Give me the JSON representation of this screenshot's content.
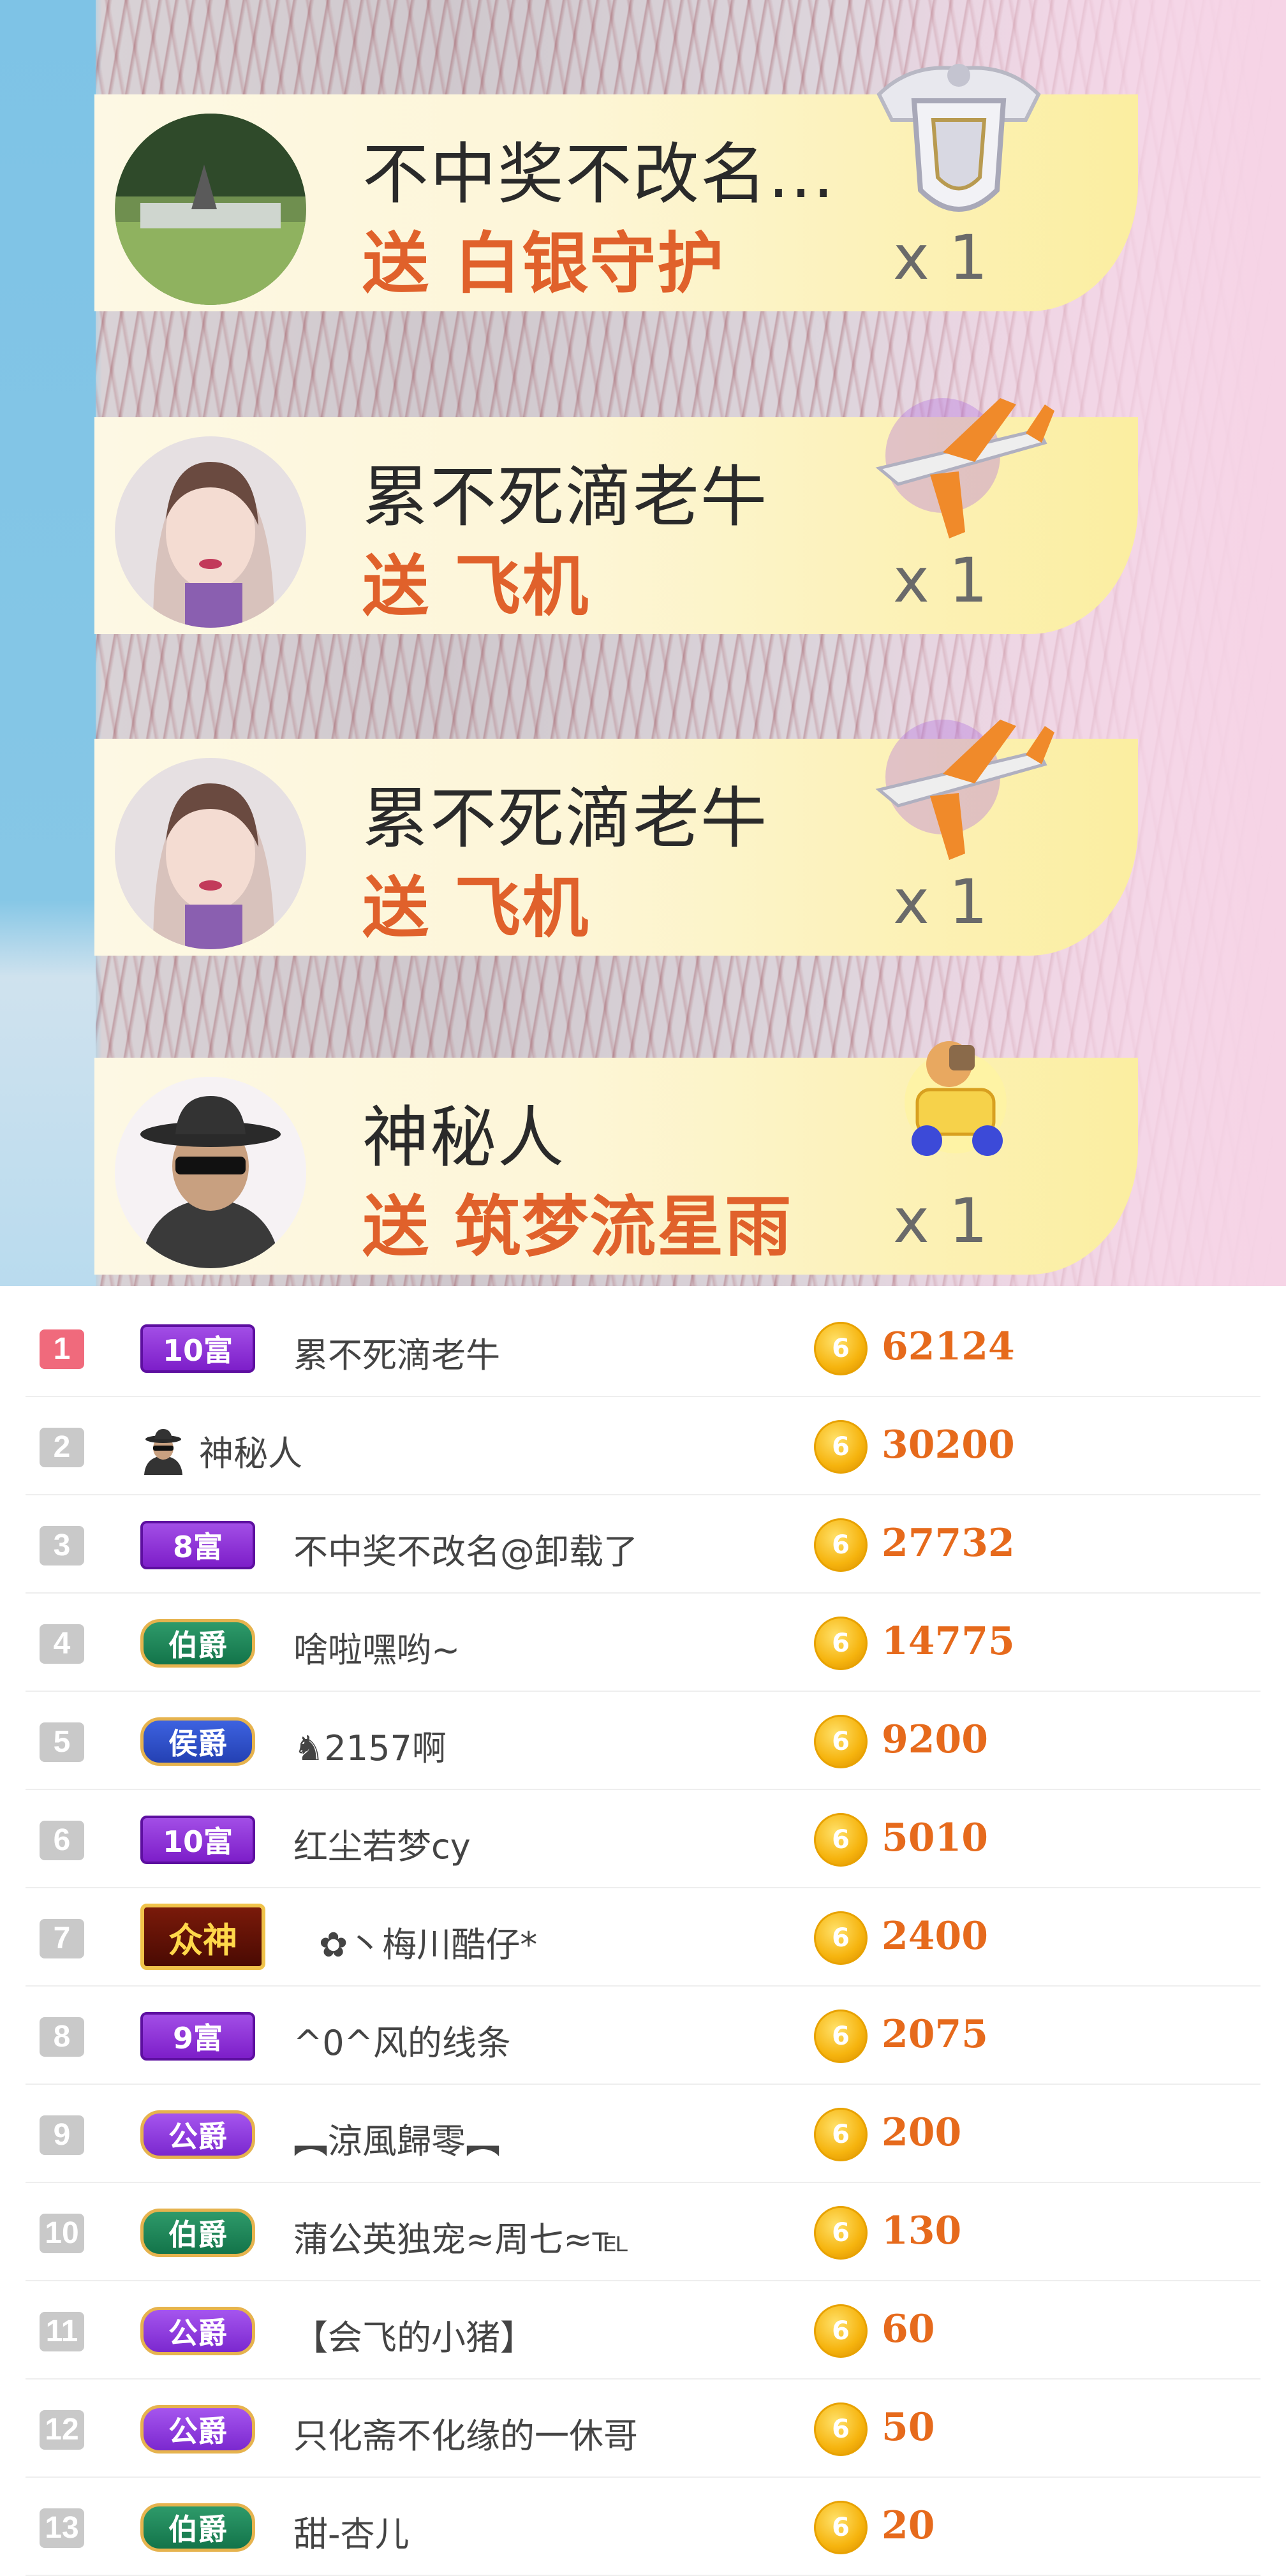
{
  "gift_stream": [
    {
      "sender": "不中奖不改名...",
      "action": "送 白银守护",
      "count": "x 1",
      "gift_icon": "silver-guard-shield-icon",
      "avatar": "landscape-photo"
    },
    {
      "sender": "累不死滴老牛",
      "action": "送 飞机",
      "count": "x 1",
      "gift_icon": "airplane-icon",
      "avatar": "woman-portrait"
    },
    {
      "sender": "累不死滴老牛",
      "action": "送 飞机",
      "count": "x 1",
      "gift_icon": "airplane-icon",
      "avatar": "woman-portrait"
    },
    {
      "sender": "神秘人",
      "action": "送 筑梦流星雨",
      "count": "x 1",
      "gift_icon": "meteor-car-icon",
      "avatar": "mystery-man"
    }
  ],
  "ranking": [
    {
      "rank": "1",
      "badge": "10富",
      "badge_type": "fu",
      "name": "累不死滴老牛",
      "score": "62124"
    },
    {
      "rank": "2",
      "badge": "",
      "badge_type": "mystery",
      "name": "神秘人",
      "score": "30200"
    },
    {
      "rank": "3",
      "badge": "8富",
      "badge_type": "fu",
      "name": "不中奖不改名@卸载了",
      "score": "27732"
    },
    {
      "rank": "4",
      "badge": "伯爵",
      "badge_type": "bo",
      "name": "啥啦嘿哟~",
      "score": "14775"
    },
    {
      "rank": "5",
      "badge": "侯爵",
      "badge_type": "hou",
      "name": "♞2157啊",
      "score": "9200"
    },
    {
      "rank": "6",
      "badge": "10富",
      "badge_type": "fu",
      "name": "红尘若梦cy",
      "score": "5010"
    },
    {
      "rank": "7",
      "badge": "众神",
      "badge_type": "zhong",
      "name": "✿丶梅川酷仔*",
      "score": "2400"
    },
    {
      "rank": "8",
      "badge": "9富",
      "badge_type": "fu",
      "name": "^0^风的线条",
      "score": "2075"
    },
    {
      "rank": "9",
      "badge": "公爵",
      "badge_type": "gong",
      "name": "︻涼風歸零︻",
      "score": "200"
    },
    {
      "rank": "10",
      "badge": "伯爵",
      "badge_type": "bo",
      "name": "蒲公英独宠≈周七≈℡",
      "score": "130"
    },
    {
      "rank": "11",
      "badge": "公爵",
      "badge_type": "gong",
      "name": "【会飞的小猪】",
      "score": "60"
    },
    {
      "rank": "12",
      "badge": "公爵",
      "badge_type": "gong",
      "name": "只化斋不化缘的一休哥",
      "score": "50"
    },
    {
      "rank": "13",
      "badge": "伯爵",
      "badge_type": "bo",
      "name": "甜-杏儿",
      "score": "20"
    }
  ],
  "coin_icon": "coin-icon",
  "coin_symbol": "6",
  "colors": {
    "first_rank": "#f06a7c",
    "score": "#e66a1c",
    "action": "#e0612b"
  }
}
